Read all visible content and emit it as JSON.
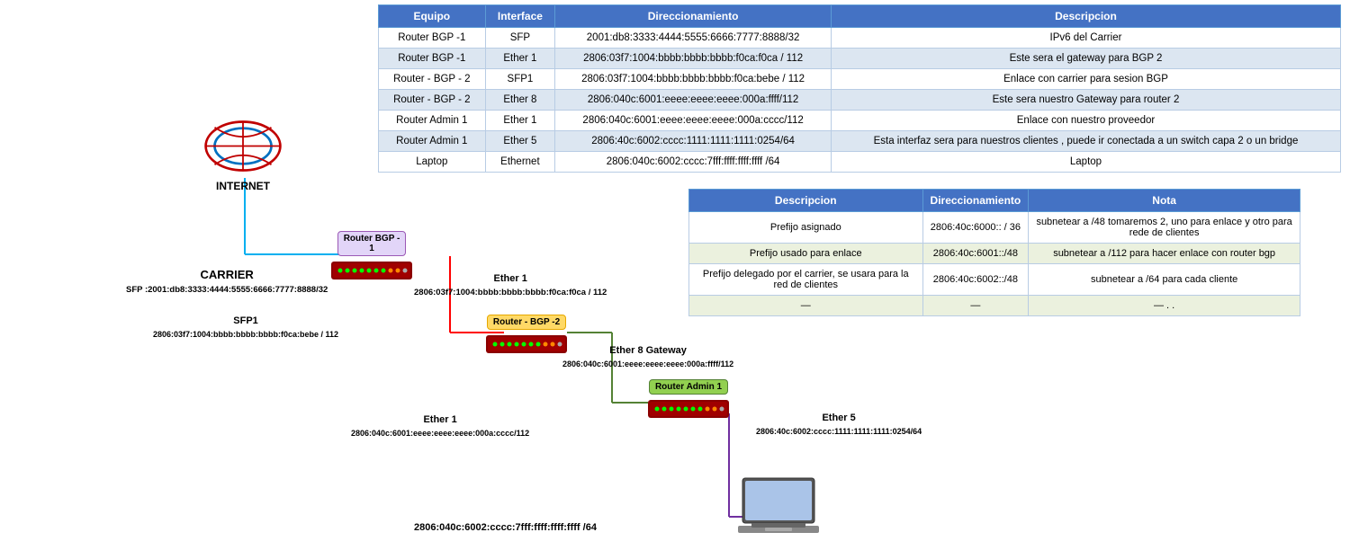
{
  "mainTable": {
    "headers": [
      "Equipo",
      "Interface",
      "Direccionamiento",
      "Descripcion"
    ],
    "rows": [
      [
        "Router BGP -1",
        "SFP",
        "2001:db8:3333:4444:5555:6666:7777:8888/32",
        "IPv6 del Carrier"
      ],
      [
        "Router BGP -1",
        "Ether 1",
        "2806:03f7:1004:bbbb:bbbb:bbbb:f0ca:f0ca / 112",
        "Este sera el gateway para BGP 2"
      ],
      [
        "Router - BGP - 2",
        "SFP1",
        "2806:03f7:1004:bbbb:bbbb:bbbb:f0ca:bebe / 112",
        "Enlace con carrier para sesion BGP"
      ],
      [
        "Router - BGP - 2",
        "Ether 8",
        "2806:040c:6001:eeee:eeee:eeee:000a:ffff/112",
        "Este sera nuestro Gateway para router 2"
      ],
      [
        "Router Admin 1",
        "Ether 1",
        "2806:040c:6001:eeee:eeee:eeee:000a:cccc/112",
        "Enlace con nuestro proveedor"
      ],
      [
        "Router Admin 1",
        "Ether 5",
        "2806:40c:6002:cccc:1111:1111:1111:0254/64",
        "Esta interfaz sera para nuestros clientes , puede ir conectada a un switch capa 2 o un bridge"
      ],
      [
        "Laptop",
        "Ethernet",
        "2806:040c:6002:cccc:7fff:ffff:ffff:ffff /64",
        "Laptop"
      ]
    ]
  },
  "secTable": {
    "headers": [
      "Descripcion",
      "Direccionamiento",
      "Nota"
    ],
    "rows": [
      [
        "Prefijo asignado",
        "2806:40c:6000:: / 36",
        "subnetear a /48  tomaremos 2, uno para enlace y otro para rede de clientes"
      ],
      [
        "Prefijo usado para enlace",
        "2806:40c:6001::/48",
        "subnetear a /112 para hacer enlace con router bgp"
      ],
      [
        "Prefijo delegado por el carrier, se usara para la red de clientes",
        "2806:40c:6002::/48",
        "subnetear a /64 para cada cliente"
      ],
      [
        "—",
        "—",
        "— . ."
      ]
    ]
  },
  "diagram": {
    "internetLabel": "INTERNET",
    "carrier": {
      "label": "CARRIER",
      "sfp": "SFP :2001:db8:3333:4444:5555:6666:7777:8888/32"
    },
    "routerBGP1": {
      "label": "Router BGP -\n1",
      "ether1Label": "Ether 1",
      "ether1Addr": "2806:03f7:1004:bbbb:bbbb:bbbb:f0ca:f0ca / 112"
    },
    "routerBGP2": {
      "label": "Router - BGP -2",
      "sfp1Label": "SFP1",
      "sfp1Addr": "2806:03f7:1004:bbbb:bbbb:bbbb:f0ca:bebe / 112",
      "ether8Label": "Ether 8 Gateway",
      "ether8Addr": "2806:040c:6001:eeee:eeee:eeee:000a:ffff/112",
      "ether1Label": "Ether 1",
      "ether1Addr": "2806:040c:6001:eeee:eeee:eeee:000a:cccc/112"
    },
    "routerAdmin1": {
      "label": "Router Admin 1",
      "ether5Label": "Ether 5",
      "ether5Addr": "2806:40c:6002:cccc:1111:1111:1111:0254/64"
    },
    "laptop": {
      "addr": "2806:040c:6002:cccc:7fff:ffff:ffff:ffff /64"
    }
  }
}
